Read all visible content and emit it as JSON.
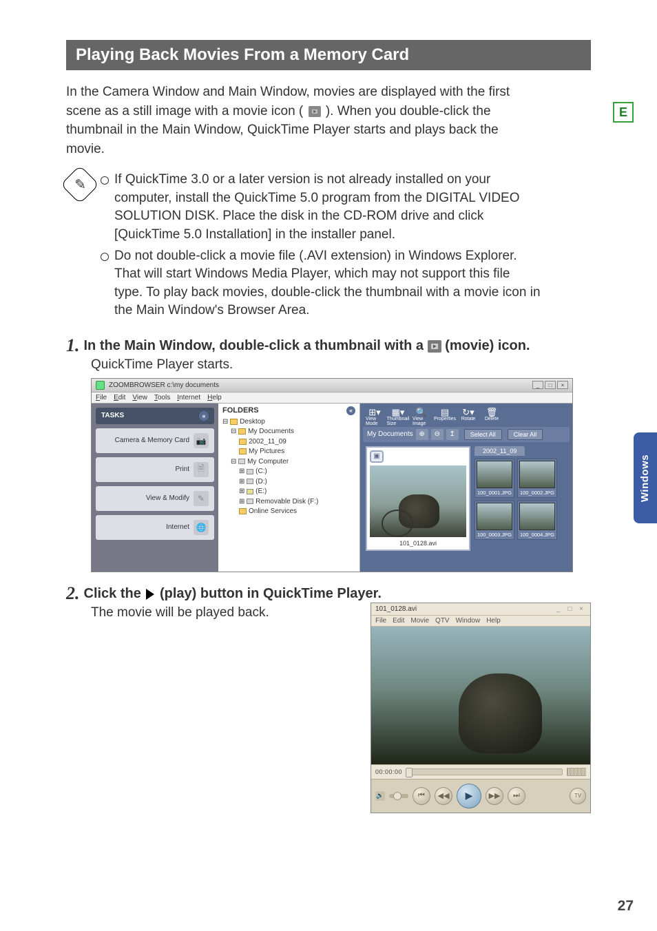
{
  "page": {
    "section_title": "Playing Back Movies From a Memory Card",
    "intro_pre": "In the Camera Window and Main Window, movies are displayed with the first scene as a still image with a movie icon ( ",
    "intro_post": " ). When you double-click the thumbnail in the Main Window, QuickTime Player starts and plays back the movie.",
    "side_e": "E",
    "side_tab": "Windows",
    "page_number": "27"
  },
  "notes": {
    "item1": "If QuickTime 3.0 or a later version is not already installed on your computer, install the QuickTime 5.0 program from the DIGITAL VIDEO SOLUTION DISK.  Place the disk in the CD-ROM drive and click [QuickTime 5.0 Installation] in the installer panel.",
    "item2": "Do not double-click a movie file (.AVI extension) in Windows Explorer.  That will start Windows Media Player, which may not support this file type. To play back movies, double-click the thumbnail with a movie icon in the Main Window's Browser Area."
  },
  "steps": {
    "s1_num": "1.",
    "s1_title_pre": "In the Main Window, double-click a thumbnail with a ",
    "s1_title_post": " (movie) icon.",
    "s1_sub": "QuickTime Player starts.",
    "s2_num": "2.",
    "s2_title_pre": "Click the ",
    "s2_title_post": " (play) button in QuickTime Player.",
    "s2_sub": "The movie will be played back."
  },
  "zoombrowser": {
    "window_title": "ZOOMBROWSER c:\\my documents",
    "menu": {
      "file": "File",
      "edit": "Edit",
      "view": "View",
      "tools": "Tools",
      "internet": "Internet",
      "help": "Help"
    },
    "tasks_label": "TASKS",
    "task_buttons": {
      "camera": "Camera & Memory Card",
      "print": "Print",
      "view_modify": "View & Modify",
      "internet": "Internet"
    },
    "folders_label": "FOLDERS",
    "tree": {
      "desktop": "Desktop",
      "my_documents": "My Documents",
      "date_folder": "2002_11_09",
      "my_pictures": "My Pictures",
      "my_computer": "My Computer",
      "drive_c": "(C:)",
      "drive_d": "(D:)",
      "drive_e": "(E:)",
      "removable": "Removable Disk (F:)",
      "online": "Online Services"
    },
    "toolbar": {
      "view_mode": "View Mode",
      "thumbnail_size": "Thumbnail Size",
      "view_image": "View Image",
      "properties": "Properties",
      "rotate": "Rotate",
      "delete": "Delete"
    },
    "path_label": "My Documents",
    "select_all": "Select All",
    "clear_all": "Clear All",
    "date_group": "2002_11_09",
    "preview_caption": "101_0128.avi",
    "thumbs": {
      "t1": "100_0001.JPG",
      "t2": "100_0002.JPG",
      "t3": "100_0003.JPG",
      "t4": "100_0004.JPG"
    }
  },
  "quicktime": {
    "title": "101_0128.avi",
    "menu": {
      "file": "File",
      "edit": "Edit",
      "movie": "Movie",
      "qtv": "QTV",
      "window": "Window",
      "help": "Help"
    },
    "time": "00:00:00",
    "tv": "TV"
  }
}
